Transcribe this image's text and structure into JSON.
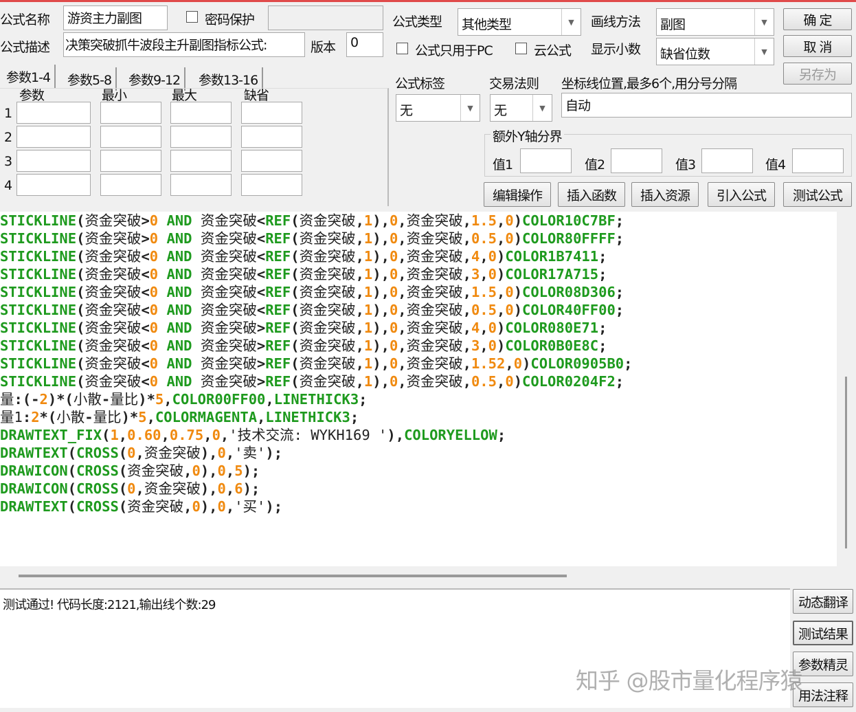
{
  "form": {
    "name_label": "公式名称",
    "name_value": "游资主力副图",
    "password_label": "密码保护",
    "desc_label": "公式描述",
    "desc_value": "决策突破抓牛波段主升副图指标公式:",
    "version_label": "版本",
    "version_value": "0",
    "type_label": "公式类型",
    "type_value": "其他类型",
    "draw_label": "画线方法",
    "draw_value": "副图",
    "pc_only_label": "公式只用于PC",
    "cloud_label": "云公式",
    "decimal_label": "显示小数",
    "decimal_value": "缺省位数",
    "tag_label": "公式标签",
    "tag_value": "无",
    "trade_label": "交易法则",
    "trade_value": "无",
    "axis_label": "坐标线位置,最多6个,用分号分隔",
    "axis_value": "自动",
    "yaxis_group": "额外Y轴分界",
    "yvals": [
      "值1",
      "值2",
      "值3",
      "值4"
    ]
  },
  "buttons": {
    "ok": "确  定",
    "cancel": "取  消",
    "save_as": "另存为",
    "edit": "编辑操作",
    "insert_fn": "插入函数",
    "insert_res": "插入资源",
    "import": "引入公式",
    "test": "测试公式",
    "translate": "动态翻译",
    "result": "测试结果",
    "wizard": "参数精灵",
    "usage": "用法注释"
  },
  "params": {
    "tabs": [
      "参数1-4",
      "参数5-8",
      "参数9-12",
      "参数13-16"
    ],
    "headers": [
      "参数",
      "最小",
      "最大",
      "缺省"
    ],
    "rows": [
      "1",
      "2",
      "3",
      "4"
    ]
  },
  "code_lines": [
    "STICKLINE(资金突破>0 AND 资金突破<REF(资金突破,1),0,资金突破,1.5,0)COLOR10C7BF;",
    "STICKLINE(资金突破>0 AND 资金突破<REF(资金突破,1),0,资金突破,0.5,0)COLOR80FFFF;",
    "STICKLINE(资金突破<0 AND 资金突破<REF(资金突破,1),0,资金突破,4,0)COLOR1B7411;",
    "STICKLINE(资金突破<0 AND 资金突破<REF(资金突破,1),0,资金突破,3,0)COLOR17A715;",
    "STICKLINE(资金突破<0 AND 资金突破<REF(资金突破,1),0,资金突破,1.5,0)COLOR08D306;",
    "STICKLINE(资金突破<0 AND 资金突破<REF(资金突破,1),0,资金突破,0.5,0)COLOR40FF00;",
    "STICKLINE(资金突破<0 AND 资金突破>REF(资金突破,1),0,资金突破,4,0)COLOR080E71;",
    "STICKLINE(资金突破<0 AND 资金突破>REF(资金突破,1),0,资金突破,3,0)COLOR0B0E8C;",
    "STICKLINE(资金突破<0 AND 资金突破>REF(资金突破,1),0,资金突破,1.52,0)COLOR0905B0;",
    "STICKLINE(资金突破<0 AND 资金突破>REF(资金突破,1),0,资金突破,0.5,0)COLOR0204F2;",
    "量:(-2)*(小散-量比)*5,COLOR00FF00,LINETHICK3;",
    "量1:2*(小散-量比)*5,COLORMAGENTA,LINETHICK3;",
    "DRAWTEXT_FIX(1,0.60,0.75,0,'技术交流: WYKH169 '),COLORYELLOW;",
    "DRAWTEXT(CROSS(0,资金突破),0,'卖');",
    "DRAWICON(CROSS(资金突破,0),0,5);",
    "DRAWICON(CROSS(0,资金突破),0,6);",
    "DRAWTEXT(CROSS(资金突破,0),0,'买');"
  ],
  "status": "测试通过! 代码长度:2121,输出线个数:29",
  "watermark": "知乎 @股市量化程序猿",
  "colors": {
    "keyword": "#1e9a1e",
    "number": "#f08a10",
    "top_border": "#e04a4a"
  }
}
